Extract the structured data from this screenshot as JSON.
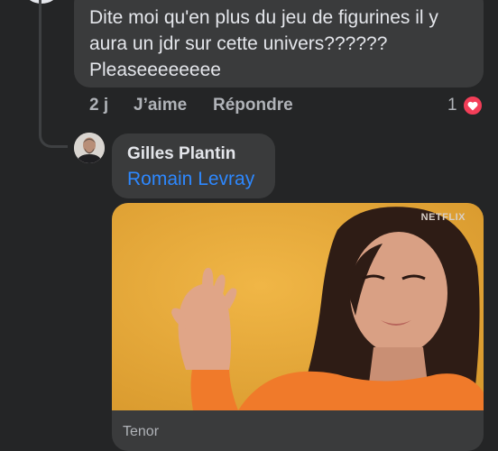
{
  "comment": {
    "text": "Dite moi qu'en plus du jeu de figurines il y\naura un jdr sur cette univers??????\nPleaseeeeeeee",
    "time": "2 j",
    "like_label": "J’aime",
    "reply_label": "Répondre",
    "reaction_count": "1"
  },
  "reply": {
    "author": "Gilles Plantin",
    "mention": "Romain Levray",
    "gif_watermark": "NETFLIX",
    "gif_source": "Tenor"
  },
  "colors": {
    "background": "#242526",
    "bubble": "#3a3b3c",
    "mention": "#2d88ff",
    "heart": "#f33e58",
    "gif_backdrop": "#e8ad3c"
  }
}
